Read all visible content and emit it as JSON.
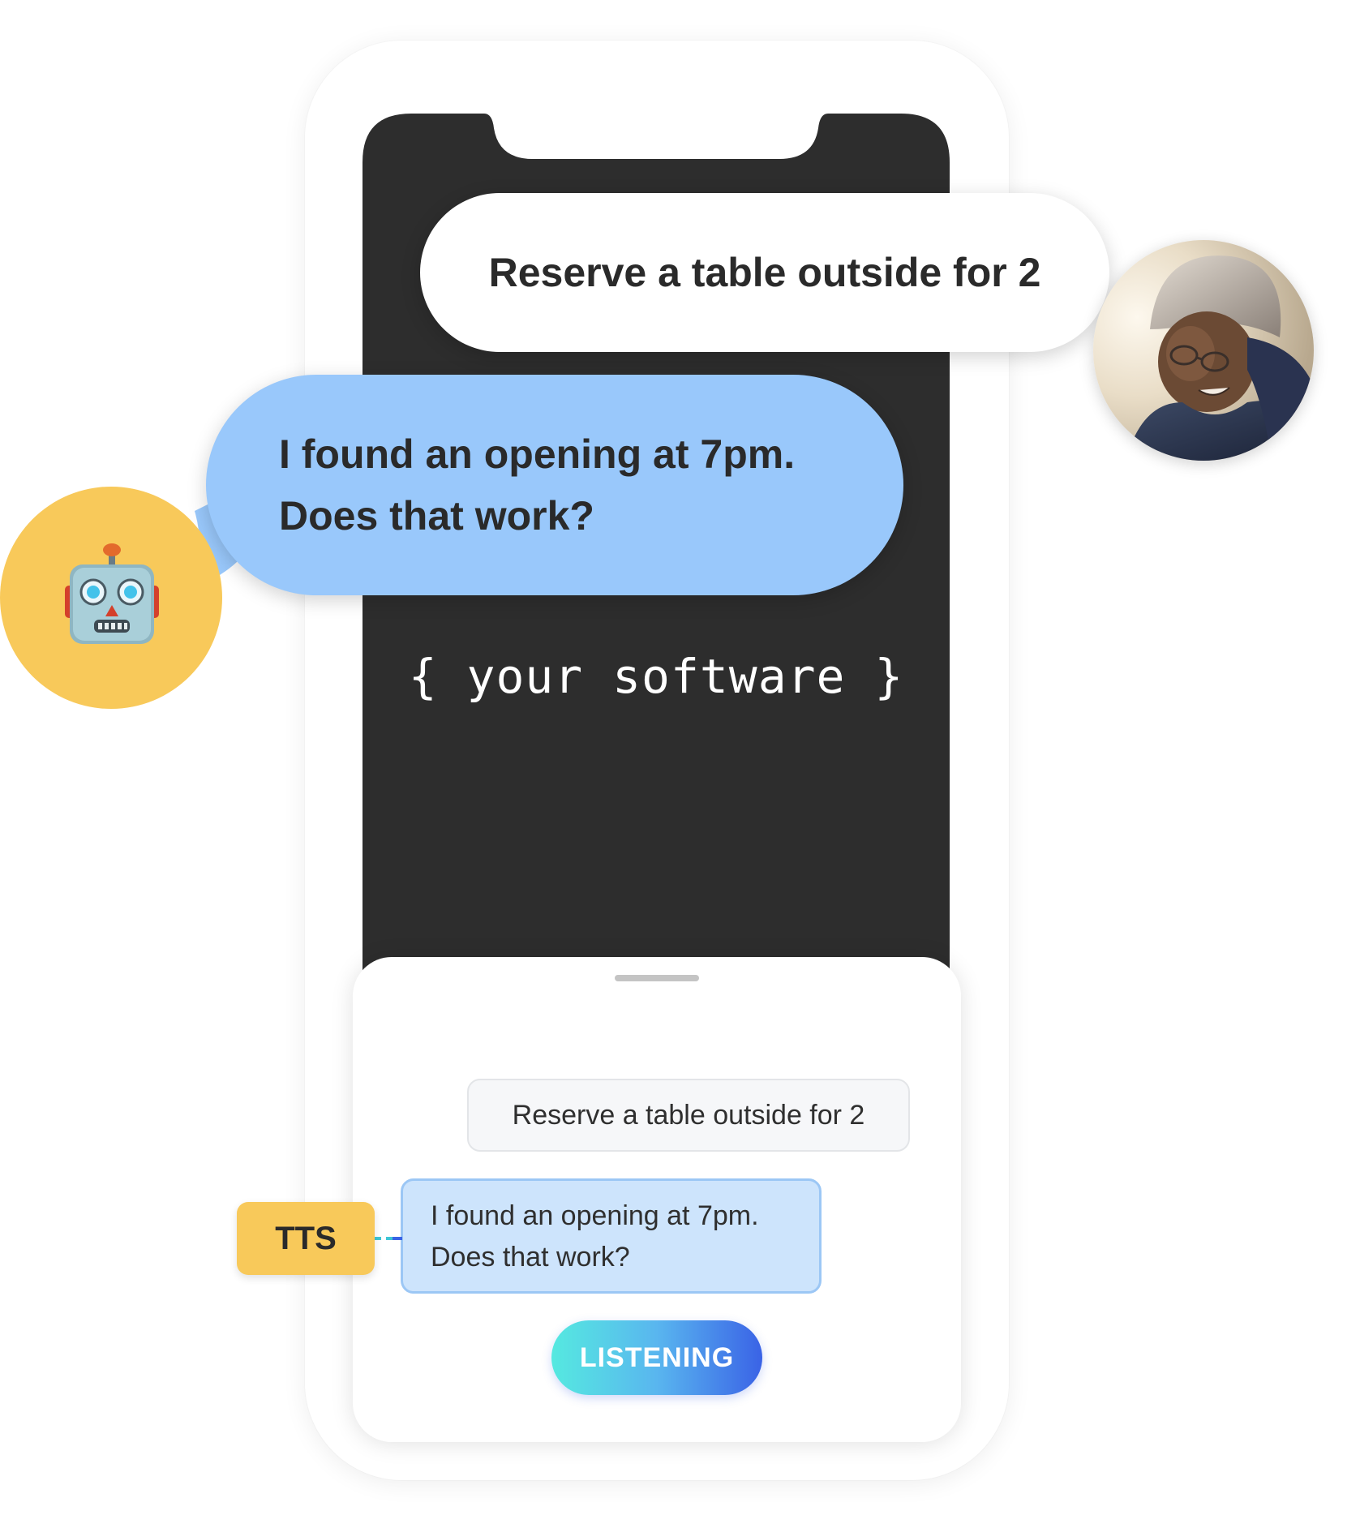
{
  "screen": {
    "software_label": "{ your software }"
  },
  "user_bubble": {
    "text": "Reserve a table outside for 2"
  },
  "bot_bubble": {
    "line1": "I found an opening at 7pm.",
    "line2": "Does that work?"
  },
  "sheet": {
    "user_message": "Reserve a table outside for 2",
    "bot_message_line1": "I found an opening at 7pm.",
    "bot_message_line2": "Does that work?",
    "tts_label": "TTS",
    "listening_label": "LISTENING"
  },
  "icons": {
    "user_avatar": "user-photo-avatar",
    "bot_avatar": "robot-face-icon"
  },
  "colors": {
    "bot_bubble": "#99c8fb",
    "accent_yellow": "#f8c95a",
    "screen_dark": "#2d2d2d",
    "bot_chip": "#cde4fc",
    "listening_gradient_start": "#55e9e0",
    "listening_gradient_end": "#3a63e6"
  }
}
